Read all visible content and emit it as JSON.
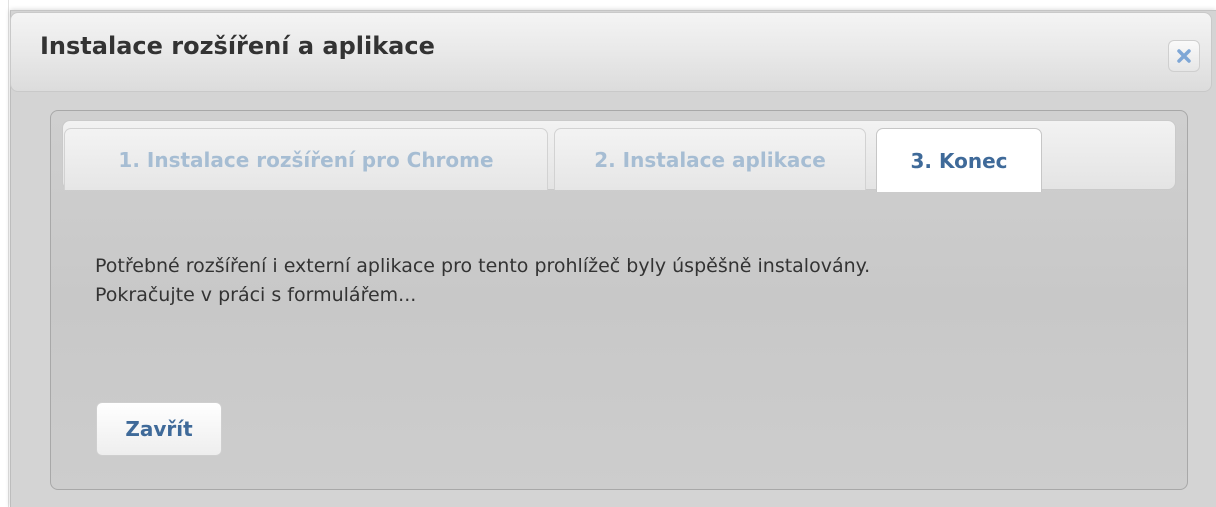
{
  "dialog": {
    "title": "Instalace rozšíření a aplikace",
    "close_icon": "close-x-icon"
  },
  "tabs": [
    {
      "label": "1. Instalace rozšíření pro Chrome",
      "active": false
    },
    {
      "label": "2. Instalace aplikace",
      "active": false
    },
    {
      "label": "3. Konec",
      "active": true
    }
  ],
  "content": {
    "message_line1": "Potřebné rozšíření i externí aplikace pro tento prohlížeč byly úspěšně instalovány.",
    "message_line2": "Pokračujte v práci s formulářem...",
    "close_button_label": "Zavřít"
  },
  "colors": {
    "accent_text": "#3f6a99",
    "inactive_tab_text": "#a6bdd3",
    "close_icon": "#7fa7d6"
  }
}
